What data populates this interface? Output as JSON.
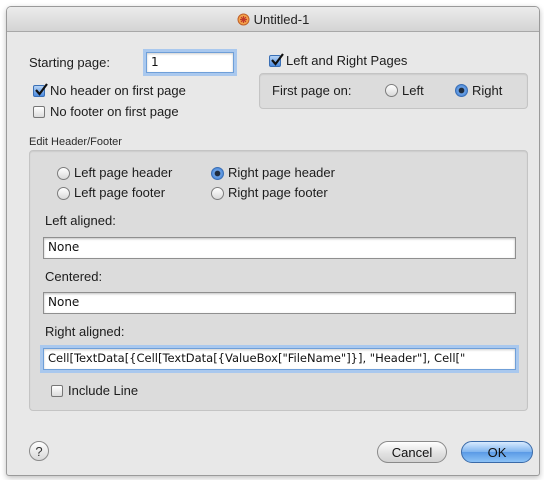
{
  "window": {
    "title": "Untitled-1"
  },
  "page_setup": {
    "starting_page_label": "Starting page:",
    "starting_page_value": "1",
    "no_header_first_page": {
      "label": "No header on first page",
      "checked": true
    },
    "no_footer_first_page": {
      "label": "No footer on first page",
      "checked": false
    },
    "left_and_right_pages": {
      "label": "Left and Right Pages",
      "checked": true
    },
    "first_page_on_label": "First page on:",
    "first_page_left": {
      "label": "Left",
      "selected": false
    },
    "first_page_right": {
      "label": "Right",
      "selected": true
    }
  },
  "edit_group": {
    "title": "Edit Header/Footer",
    "left_page_header": {
      "label": "Left page header",
      "selected": false
    },
    "right_page_header": {
      "label": "Right page header",
      "selected": true
    },
    "left_page_footer": {
      "label": "Left page footer",
      "selected": false
    },
    "right_page_footer": {
      "label": "Right page footer",
      "selected": false
    },
    "left_aligned_label": "Left aligned:",
    "left_aligned_value": "None",
    "centered_label": "Centered:",
    "centered_value": "None",
    "right_aligned_label": "Right aligned:",
    "right_aligned_value": "Cell[TextData[{Cell[TextData[{ValueBox[\"FileName\"]}], \"Header\"], Cell[\"",
    "include_line": {
      "label": "Include Line",
      "checked": false
    }
  },
  "buttons": {
    "help": "?",
    "cancel": "Cancel",
    "ok": "OK"
  },
  "colors": {
    "accent": "#4a86d6",
    "window_bg": "#e8e8e8",
    "group_bg": "#dcdcdc"
  }
}
